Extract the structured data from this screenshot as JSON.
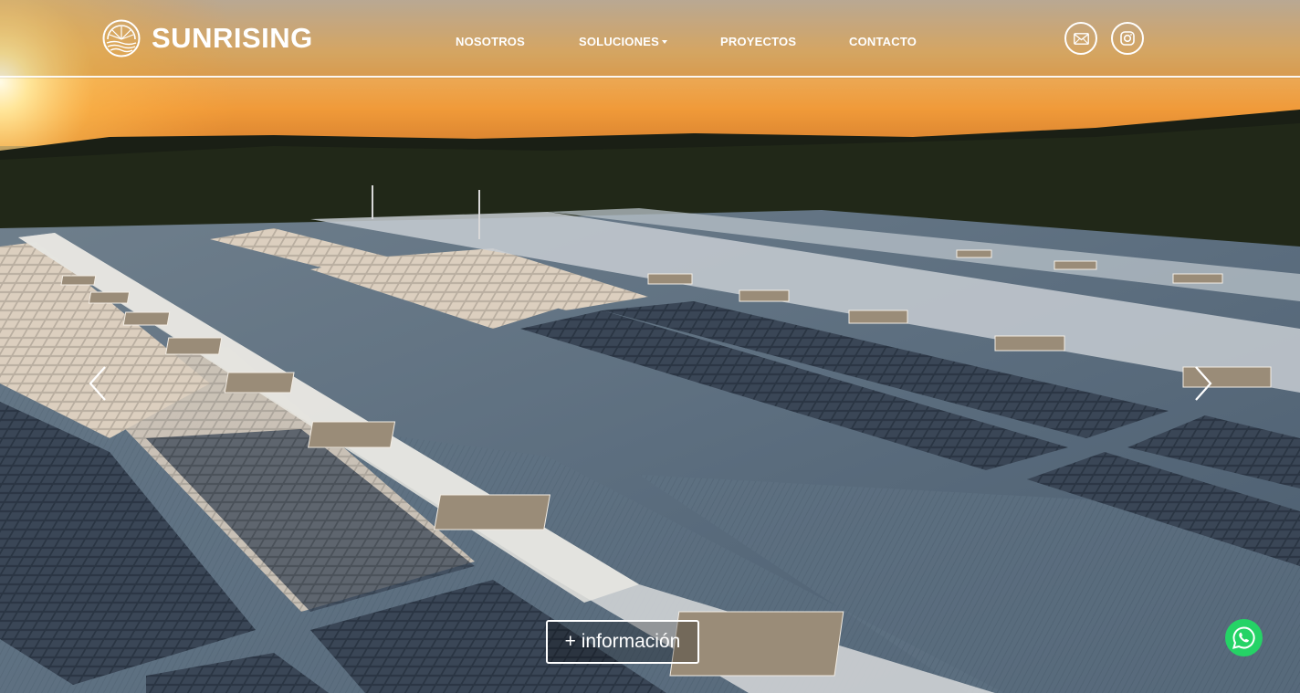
{
  "brand": {
    "name": "SUNRISING",
    "logo_icon": "sun-logo-icon"
  },
  "nav": {
    "items": [
      {
        "label": "NOSOTROS",
        "has_dropdown": false
      },
      {
        "label": "SOLUCIONES",
        "has_dropdown": true
      },
      {
        "label": "PROYECTOS",
        "has_dropdown": false
      },
      {
        "label": "CONTACTO",
        "has_dropdown": false
      }
    ]
  },
  "social": {
    "icons": [
      "mail-icon",
      "instagram-icon"
    ]
  },
  "hero": {
    "cta_label": "+ información",
    "prev_icon": "chevron-left-icon",
    "next_icon": "chevron-right-icon"
  },
  "floating": {
    "whatsapp_icon": "whatsapp-icon",
    "whatsapp_color": "#25D366"
  },
  "colors": {
    "text": "#ffffff",
    "sunset": "#f2a23a",
    "roof": "#5f7283"
  }
}
